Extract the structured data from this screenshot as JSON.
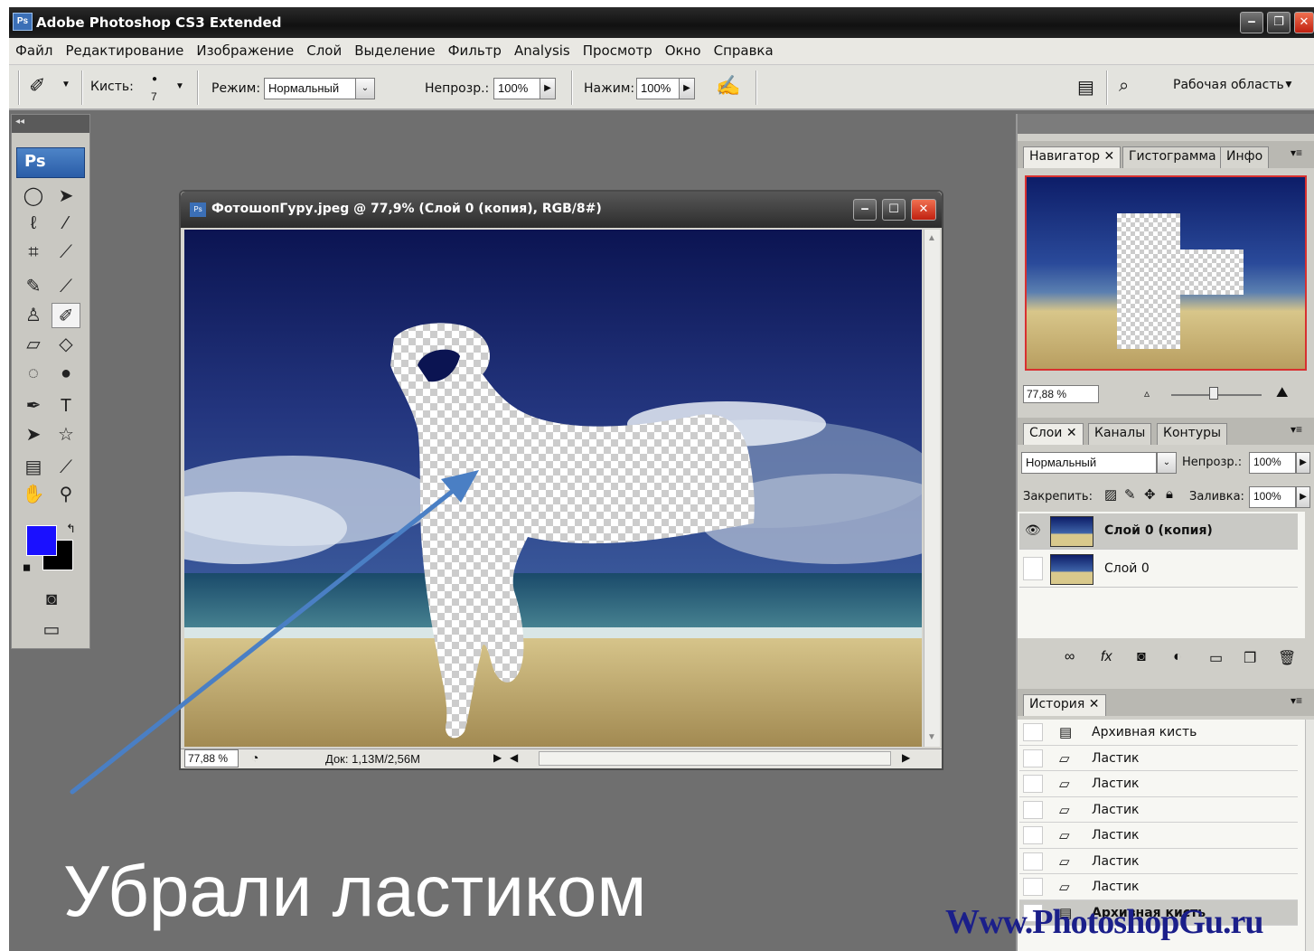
{
  "titlebar": {
    "app_icon": "Ps",
    "title": "Adobe Photoshop CS3 Extended"
  },
  "menu": [
    "Файл",
    "Редактирование",
    "Изображение",
    "Слой",
    "Выделение",
    "Фильтр",
    "Analysis",
    "Просмотр",
    "Окно",
    "Справка"
  ],
  "options": {
    "brush_label": "Кисть:",
    "brush_size": "7",
    "mode_label": "Режим:",
    "mode_value": "Нормальный",
    "opacity_label": "Непрозр.:",
    "opacity_value": "100%",
    "flow_label": "Нажим:",
    "flow_value": "100%",
    "workspace_label": "Рабочая область"
  },
  "toolbox": {
    "logo": "Ps"
  },
  "document": {
    "title": "ФотошопГуру.jpeg @ 77,9% (Слой 0 (копия), RGB/8#)",
    "zoom": "77,88 %",
    "doc_info": "Док: 1,13M/2,56M"
  },
  "navigator": {
    "tabs": [
      "Навигатор",
      "Гистограмма",
      "Инфо"
    ],
    "zoom": "77,88 %"
  },
  "layers": {
    "tabs": [
      "Слои",
      "Каналы",
      "Контуры"
    ],
    "blend_mode": "Нормальный",
    "opacity_label": "Непрозр.:",
    "opacity_value": "100%",
    "lock_label": "Закрепить:",
    "fill_label": "Заливка:",
    "fill_value": "100%",
    "items": [
      {
        "name": "Слой 0 (копия)"
      },
      {
        "name": "Слой 0"
      }
    ]
  },
  "history": {
    "tab": "История",
    "items": [
      {
        "name": "Архивная кисть"
      },
      {
        "name": "Ластик"
      },
      {
        "name": "Ластик"
      },
      {
        "name": "Ластик"
      },
      {
        "name": "Ластик"
      },
      {
        "name": "Ластик"
      },
      {
        "name": "Ластик"
      },
      {
        "name": "Архивная кисть"
      }
    ]
  },
  "caption": "Убрали ластиком",
  "watermark": "Www.PhotoshopGu.ru",
  "colors": {
    "foreground": "#1a10ff",
    "background": "#000000",
    "arrow": "#4a7fc4"
  }
}
